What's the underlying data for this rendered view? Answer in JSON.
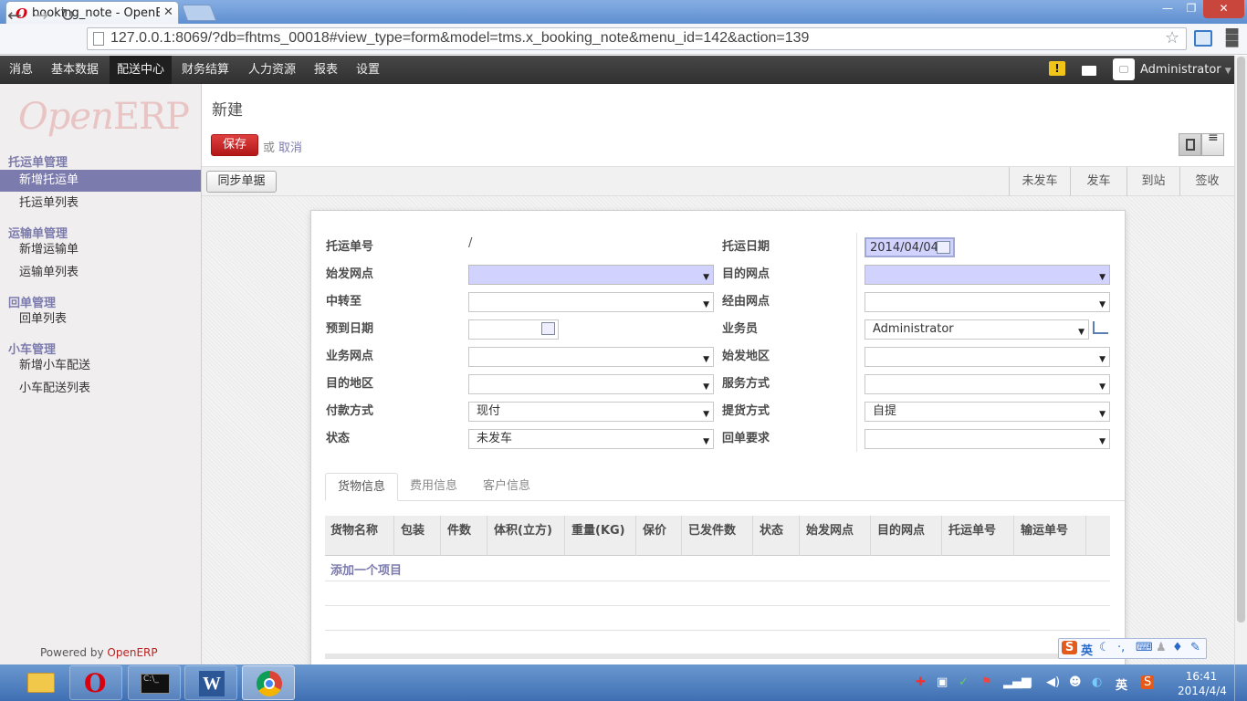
{
  "browser": {
    "tab_title": "booking_note - OpenERP",
    "tab_close": "✕",
    "url": "127.0.0.1:8069/?db=fhtms_00018#view_type=form&model=tms.x_booking_note&menu_id=142&action=139"
  },
  "top_menu": {
    "items": [
      "消息",
      "基本数据",
      "配送中心",
      "财务结算",
      "人力资源",
      "报表",
      "设置"
    ],
    "active": "配送中心",
    "warning_count": "!",
    "user": "Administrator"
  },
  "sidebar": {
    "logo_left": "Open",
    "logo_right": "ERP",
    "sections": [
      {
        "title": "托运单管理",
        "items": [
          "新增托运单",
          "托运单列表"
        ]
      },
      {
        "title": "运输单管理",
        "items": [
          "新增运输单",
          "运输单列表"
        ]
      },
      {
        "title": "回单管理",
        "items": [
          "回单列表"
        ]
      },
      {
        "title": "小车管理",
        "items": [
          "新增小车配送",
          "小车配送列表"
        ]
      }
    ],
    "active_item": "新增托运单",
    "powered_prefix": "Powered by",
    "powered_brand": "OpenERP"
  },
  "page": {
    "title": "新建",
    "save": "保存",
    "or": "或",
    "cancel": "取消",
    "sync": "同步单据",
    "stages": [
      "未发车",
      "发车",
      "到站",
      "签收"
    ]
  },
  "form": {
    "left": [
      {
        "label": "托运单号",
        "value": "/",
        "type": "readonly"
      },
      {
        "label": "始发网点",
        "value": "",
        "type": "select",
        "required": true
      },
      {
        "label": "中转至",
        "value": "",
        "type": "select"
      },
      {
        "label": "预到日期",
        "value": "",
        "type": "date"
      },
      {
        "label": "业务网点",
        "value": "",
        "type": "select"
      },
      {
        "label": "目的地区",
        "value": "",
        "type": "select"
      },
      {
        "label": "付款方式",
        "value": "现付",
        "type": "select"
      },
      {
        "label": "状态",
        "value": "未发车",
        "type": "select"
      }
    ],
    "right": [
      {
        "label": "托运日期",
        "value": "2014/04/04",
        "type": "date"
      },
      {
        "label": "目的网点",
        "value": "",
        "type": "select",
        "required": true
      },
      {
        "label": "经由网点",
        "value": "",
        "type": "select"
      },
      {
        "label": "业务员",
        "value": "Administrator",
        "type": "select"
      },
      {
        "label": "始发地区",
        "value": "",
        "type": "select"
      },
      {
        "label": "服务方式",
        "value": "",
        "type": "select"
      },
      {
        "label": "提货方式",
        "value": "自提",
        "type": "select"
      },
      {
        "label": "回单要求",
        "value": "",
        "type": "select"
      }
    ]
  },
  "tabs": [
    "货物信息",
    "费用信息",
    "客户信息"
  ],
  "grid": {
    "columns": [
      "货物名称",
      "包装",
      "件数",
      "体积(立方)",
      "重量(KG)",
      "保价",
      "已发件数",
      "状态",
      "始发网点",
      "目的网点",
      "托运单号",
      "输运单号"
    ],
    "add_item": "添加一个项目"
  },
  "ime": {
    "lang": "英"
  },
  "taskbar": {
    "time": "16:41",
    "date": "2014/4/4",
    "ime_lang": "英"
  }
}
